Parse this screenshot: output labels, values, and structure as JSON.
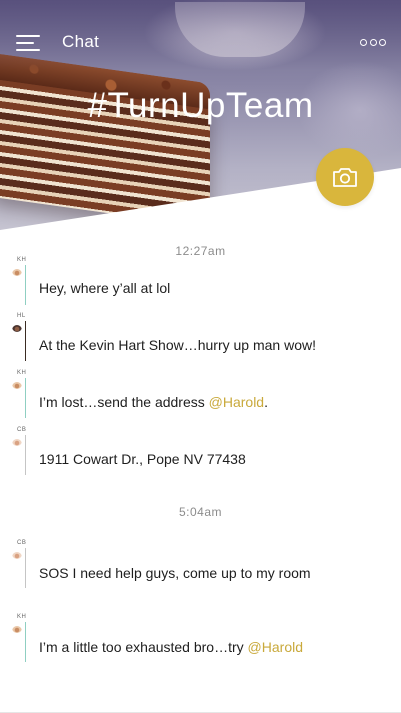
{
  "header": {
    "title": "Chat",
    "menu_icon": "hamburger-menu-icon",
    "more_icon": "more-dots-icon"
  },
  "channel": {
    "name": "#TurnUpTeam"
  },
  "camera": {
    "icon": "camera-icon",
    "color": "#d9b63c"
  },
  "accent_colors": {
    "mention": "#c9a93b",
    "rule_kh": "#8fcfc2",
    "rule_hl": "#3a2b22"
  },
  "timestamps": [
    "12:27am",
    "5:04am"
  ],
  "messages": [
    {
      "initials": "KH",
      "text": "Hey, where y’all at lol",
      "mention": ""
    },
    {
      "initials": "HL",
      "text": "At the Kevin Hart Show…hurry up man wow!",
      "mention": ""
    },
    {
      "initials": "KH",
      "text": "I’m lost…send the address ",
      "mention": "@Harold",
      "suffix": "."
    },
    {
      "initials": "CB",
      "text": "1911 Cowart Dr., Pope NV 77438",
      "mention": ""
    },
    {
      "initials": "CB",
      "text": "SOS I need help guys, come up to my room",
      "mention": ""
    },
    {
      "initials": "KH",
      "text": "I’m a little too exhausted bro…try ",
      "mention": "@Harold",
      "suffix": ""
    }
  ]
}
